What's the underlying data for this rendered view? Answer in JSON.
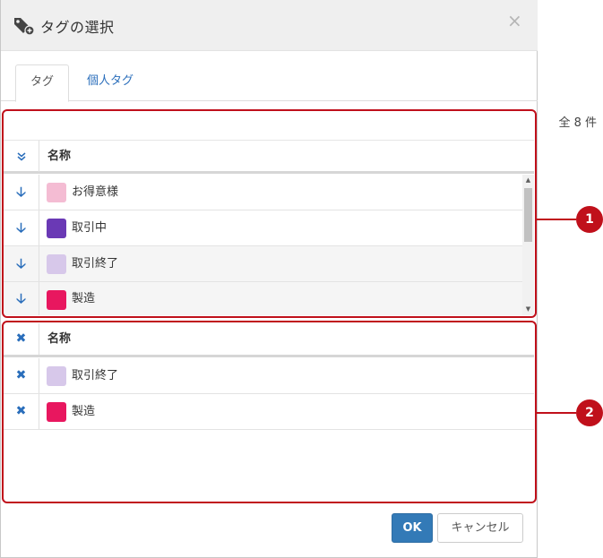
{
  "dialog": {
    "title": "タグの選択",
    "close_label": "×"
  },
  "tabs": [
    {
      "label": "タグ",
      "active": true
    },
    {
      "label": "個人タグ",
      "active": false
    }
  ],
  "available": {
    "count_label": "全 8 件",
    "header_icon": "double-chevron-down-icon",
    "column_name": "名称",
    "rows": [
      {
        "label": "お得意様",
        "color": "#f4bcd3",
        "icon": "arrow-down-icon"
      },
      {
        "label": "取引中",
        "color": "#6a39b5",
        "icon": "arrow-down-icon"
      },
      {
        "label": "取引終了",
        "color": "#d7c8ea",
        "icon": "arrow-down-icon"
      },
      {
        "label": "製造",
        "color": "#e8175f",
        "icon": "arrow-down-icon"
      }
    ]
  },
  "selected": {
    "header_icon": "remove-icon",
    "column_name": "名称",
    "rows": [
      {
        "label": "取引終了",
        "color": "#d7c8ea",
        "icon": "remove-icon"
      },
      {
        "label": "製造",
        "color": "#e8175f",
        "icon": "remove-icon"
      }
    ]
  },
  "callouts": [
    "1",
    "2"
  ],
  "buttons": {
    "ok": "OK",
    "cancel": "キャンセル"
  },
  "accent_color": "#337ab7",
  "callout_color": "#c0101b"
}
